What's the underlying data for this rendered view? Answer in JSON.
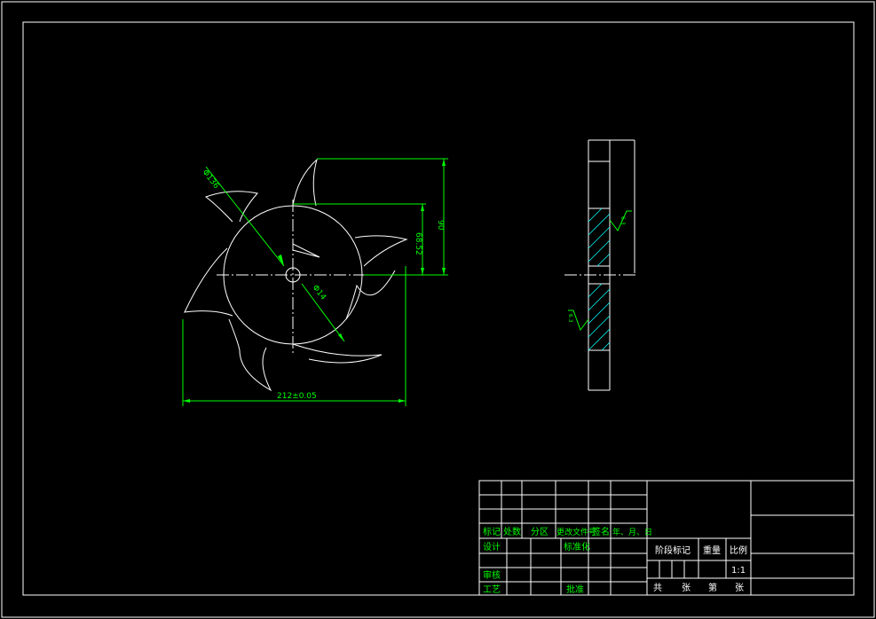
{
  "colors": {
    "background": "#000000",
    "outline": "#ffffff",
    "dimension": "#00ff00",
    "hatch": "#00ffff"
  },
  "front_view": {
    "dim_outer_dia": "Φ136",
    "dim_hub_dia": "Φ14",
    "dim_width": "212±0.05",
    "dim_height_total": "90",
    "dim_height_inner": "68.52"
  },
  "side_view": {
    "roughness_top": "6.3",
    "roughness_bottom": "6.3"
  },
  "title_block": {
    "r1": [
      "标记",
      "处数",
      "分区",
      "更改文件号",
      "签名",
      "年、月、日"
    ],
    "design": "设计",
    "standard": "标准化",
    "review": "审核",
    "process": "工艺",
    "approve": "批准",
    "stage_mark": "阶段标记",
    "weight": "重量",
    "scale_label": "比例",
    "scale_value": "1:1",
    "sheets": [
      "共",
      "张",
      "第",
      "张"
    ]
  }
}
